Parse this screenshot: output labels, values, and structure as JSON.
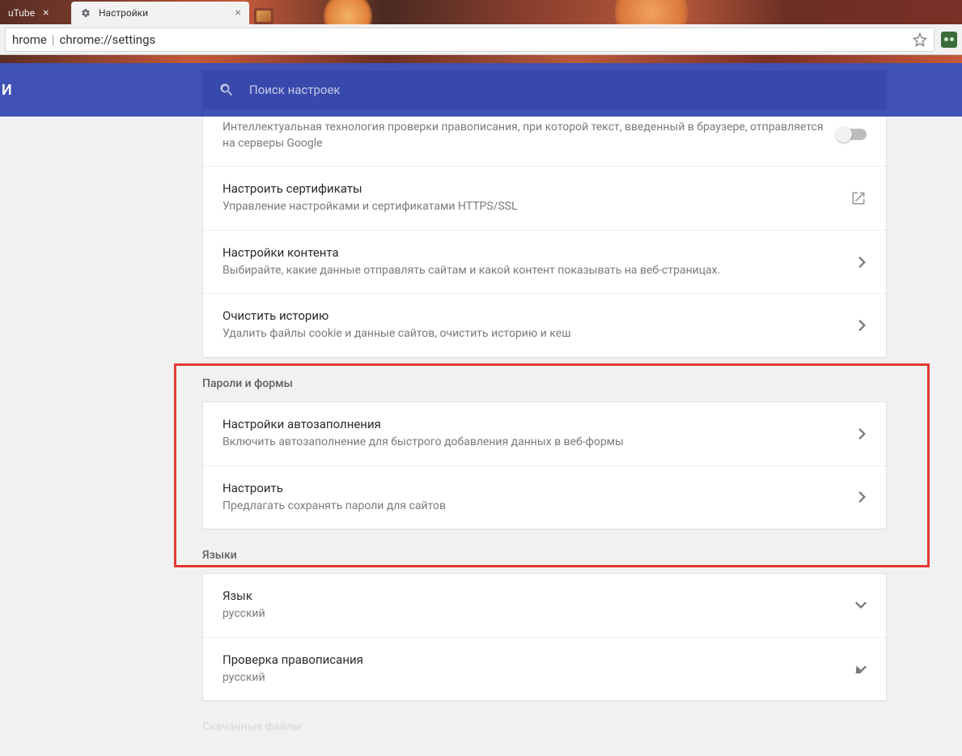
{
  "tabs": [
    {
      "label": "uTube"
    },
    {
      "label": "Настройки"
    }
  ],
  "address": {
    "protocol_label": "hrome",
    "url": "chrome://settings"
  },
  "header": {
    "truncated": "И"
  },
  "search": {
    "placeholder": "Поиск настроек"
  },
  "privacy": {
    "items": [
      {
        "title": "",
        "sub": "Интеллектуальная технология проверки правописания, при которой текст, введенный в браузере, отправляется на серверы Google"
      },
      {
        "title": "Настроить сертификаты",
        "sub": "Управление настройками и сертификатами HTTPS/SSL"
      },
      {
        "title": "Настройки контента",
        "sub": "Выбирайте, какие данные отправлять сайтам и какой контент показывать на веб-страницах."
      },
      {
        "title": "Очистить историю",
        "sub": "Удалить файлы cookie и данные сайтов, очистить историю и кеш"
      }
    ]
  },
  "passwords": {
    "section": "Пароли и формы",
    "items": [
      {
        "title": "Настройки автозаполнения",
        "sub": "Включить автозаполнение для быстрого добавления данных в веб-формы"
      },
      {
        "title": "Настроить",
        "sub": "Предлагать сохранять пароли для сайтов"
      }
    ]
  },
  "languages": {
    "section": "Языки",
    "items": [
      {
        "title": "Язык",
        "sub": "русский"
      },
      {
        "title": "Проверка правописания",
        "sub": "русский"
      }
    ]
  },
  "downloads": {
    "section": "Скачанные файлы"
  }
}
